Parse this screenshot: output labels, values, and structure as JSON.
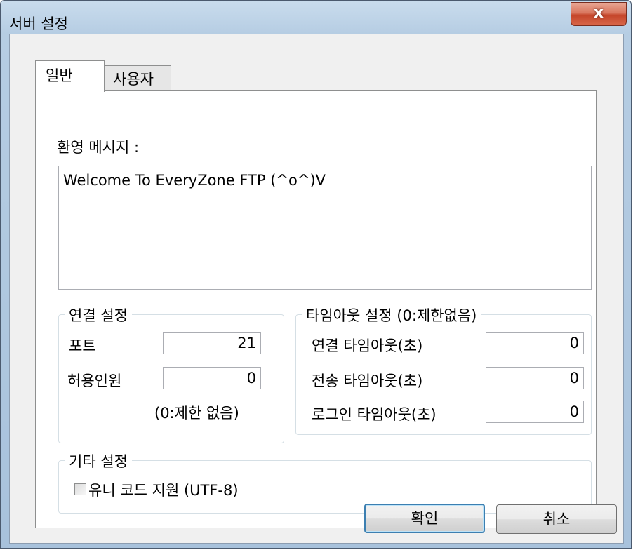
{
  "window": {
    "title": "서버 설정",
    "close_symbol": "x"
  },
  "tabs": [
    {
      "label": "일반",
      "selected": true
    },
    {
      "label": "사용자",
      "selected": false
    }
  ],
  "general": {
    "welcome_label": "환영 메시지 :",
    "welcome_message": "Welcome To EveryZone FTP (^o^)V",
    "connection": {
      "title": "연결 설정",
      "port_label": "포트",
      "port_value": "21",
      "max_users_label": "허용인원",
      "max_users_value": "0",
      "note": "(0:제한 없음)"
    },
    "timeout": {
      "title": "타임아웃 설정 (0:제한없음)",
      "connect_label": "연결 타임아웃(초)",
      "connect_value": "0",
      "transfer_label": "전송 타임아웃(초)",
      "transfer_value": "0",
      "login_label": "로그인 타임아웃(초)",
      "login_value": "0"
    },
    "other": {
      "title": "기타 설정",
      "unicode_label": "유니 코드 지원 (UTF-8)",
      "unicode_checked": false
    }
  },
  "buttons": {
    "ok": "확인",
    "cancel": "취소"
  },
  "colors": {
    "title_bar": "#b6cde3",
    "close_button": "#c4452a",
    "default_button_border": "#3c7fb1"
  }
}
